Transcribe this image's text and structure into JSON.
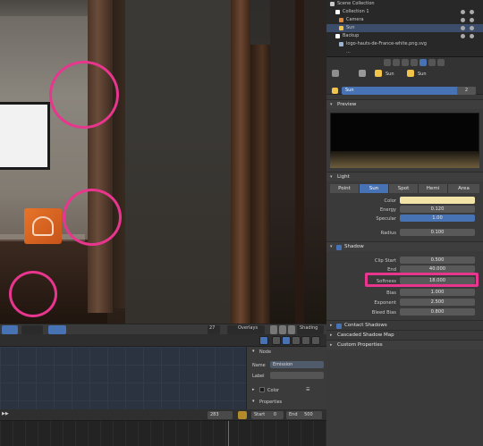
{
  "outliner": {
    "items": [
      {
        "label": "Scene Collection",
        "sel": false,
        "indent": 4
      },
      {
        "label": "Collection 1",
        "sel": false,
        "indent": 12
      },
      {
        "label": "Camera",
        "sel": false,
        "indent": 20
      },
      {
        "label": "Sun",
        "sel": true,
        "indent": 20
      },
      {
        "label": "Backup",
        "sel": false,
        "indent": 12
      },
      {
        "label": "logo-hauts-de-France-white.png.svg",
        "sel": false,
        "indent": 20
      },
      {
        "label": "...",
        "sel": false,
        "indent": 20
      }
    ]
  },
  "properties": {
    "breadcrumb_object": "Sun",
    "breadcrumb_data": "Sun",
    "name_value": "Sun",
    "name_count": "2",
    "preview_header": "Preview",
    "light_header": "Light",
    "light_types": [
      "Point",
      "Sun",
      "Spot",
      "Hemi",
      "Area"
    ],
    "light_type_selected": 1,
    "color_label": "Color",
    "energy_label": "Energy",
    "energy_value": "0.120",
    "specular_label": "Specular",
    "specular_value": "1.00",
    "radius_label": "Radius",
    "radius_value": "0.100",
    "shadow_header": "Shadow",
    "clip_start_label": "Clip Start",
    "clip_start_value": "0.500",
    "end_label": "End",
    "end_value": "40.000",
    "softness_label": "Softness",
    "softness_value": "18.000",
    "bias_label": "Bias",
    "bias_value": "1.000",
    "exponent_label": "Exponent",
    "exponent_value": "2.500",
    "bleed_bias_label": "Bleed Bias",
    "bleed_bias_value": "0.800",
    "contact_shadows_label": "Contact Shadows",
    "cascaded_label": "Cascaded Shadow Map",
    "custom_props_label": "Custom Properties"
  },
  "viewport": {
    "overlays_label": "Overlays",
    "shading_label": "Shading",
    "view_label": "27"
  },
  "node_panel": {
    "header": "Node",
    "name_label": "Name",
    "name_value": "Emission",
    "label_label": "Label",
    "color_label": "Color",
    "properties_label": "Properties"
  },
  "timeline": {
    "frame": "283",
    "start_label": "Start",
    "start_value": "0",
    "end_label": "End",
    "end_value": "500"
  },
  "colors": {
    "accent": "#4772b3",
    "annotation": "#e8368f",
    "light_color": "#f4e3a6"
  }
}
